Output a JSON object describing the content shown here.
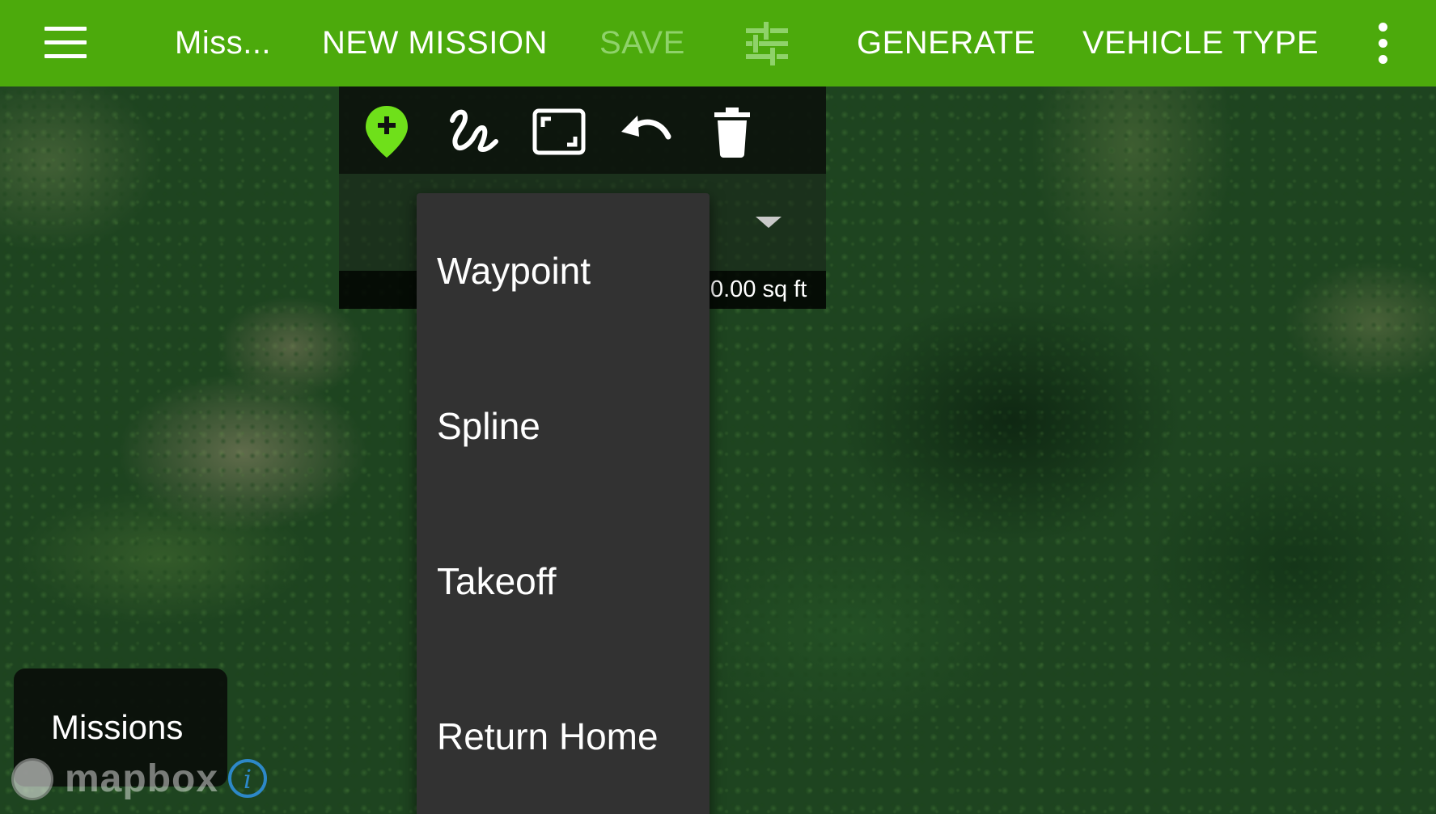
{
  "appbar": {
    "title": "Miss...",
    "new_mission": "NEW MISSION",
    "save": "SAVE",
    "generate": "GENERATE",
    "vehicle_type": "VEHICLE TYPE",
    "background_color": "#4caa0c",
    "disabled_color": "#8fd26a",
    "icons": {
      "menu": "hamburger-menu-icon",
      "tune": "tune-sliders-icon",
      "overflow": "vertical-dots-icon"
    }
  },
  "editor_toolbar": {
    "tools": [
      {
        "name": "add-waypoint-marker-icon",
        "color": "#6fe01a"
      },
      {
        "name": "draw-spline-icon",
        "color": "#ffffff"
      },
      {
        "name": "fit-bounds-icon",
        "color": "#ffffff"
      },
      {
        "name": "undo-icon",
        "color": "#ffffff"
      },
      {
        "name": "delete-trash-icon",
        "color": "#ffffff"
      }
    ],
    "area_value": "0.00 sq ft"
  },
  "waypoint_type_menu": {
    "options": [
      "Waypoint",
      "Spline",
      "Takeoff",
      "Return Home"
    ]
  },
  "missions_button": {
    "label": "Missions"
  },
  "attribution": {
    "logo_text": "mapbox",
    "info_icon": "info-icon",
    "info_glyph": "i",
    "info_color": "#2d88c8"
  }
}
